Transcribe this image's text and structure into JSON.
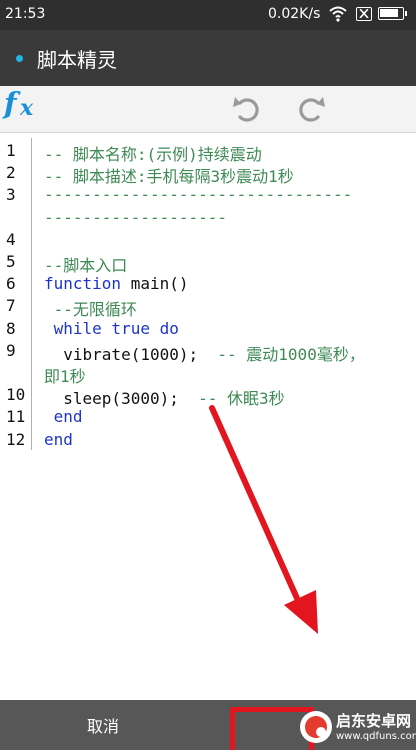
{
  "status_bar": {
    "time": "21:53",
    "net_speed": "0.02K/s",
    "battery_level": 0.9,
    "icons": [
      "wifi-icon",
      "sim-disabled-icon",
      "battery-icon"
    ]
  },
  "app_bar": {
    "title": "脚本精灵",
    "accent_color": "#1fb5e9"
  },
  "toolbar": {
    "undo_icon": "undo-icon",
    "redo_icon": "redo-icon",
    "fx_f": "f",
    "fx_x": "x",
    "fx_color": "#1b8fd8"
  },
  "editor": {
    "line_numbers": [
      "1",
      "2",
      "3",
      "4",
      "5",
      "6",
      "7",
      "8",
      "9",
      "10",
      "11",
      "12"
    ],
    "lines": [
      {
        "no": "1",
        "tokens": [
          {
            "t": "-- 脚本名称:(示例)持续震动",
            "k": "comment"
          }
        ]
      },
      {
        "no": "2",
        "tokens": [
          {
            "t": "-- 脚本描述:手机每隔3秒震动1秒",
            "k": "comment"
          }
        ]
      },
      {
        "no": "3",
        "tokens": [
          {
            "t": "--------------------------------",
            "k": "comment"
          }
        ]
      },
      {
        "no": "3b",
        "tokens": [
          {
            "t": "-------------------",
            "k": "comment"
          }
        ]
      },
      {
        "no": "4",
        "tokens": []
      },
      {
        "no": "5",
        "tokens": [
          {
            "t": "--脚本入口",
            "k": "comment"
          }
        ]
      },
      {
        "no": "6",
        "tokens": [
          {
            "t": "function",
            "k": "keyword"
          },
          {
            "t": " main()",
            "k": "plain"
          }
        ]
      },
      {
        "no": "7",
        "tokens": [
          {
            "t": " --无限循环",
            "k": "comment"
          }
        ]
      },
      {
        "no": "8",
        "tokens": [
          {
            "t": " while true do",
            "k": "keyword"
          }
        ]
      },
      {
        "no": "9",
        "tokens": [
          {
            "t": "  vibrate(1000);  ",
            "k": "plain"
          },
          {
            "t": "-- 震动1000毫秒，",
            "k": "comment"
          }
        ]
      },
      {
        "no": "9b",
        "tokens": [
          {
            "t": "即1秒",
            "k": "comment"
          }
        ]
      },
      {
        "no": "10",
        "tokens": [
          {
            "t": "  sleep(3000);  ",
            "k": "plain"
          },
          {
            "t": "-- 休眠3秒",
            "k": "comment"
          }
        ]
      },
      {
        "no": "11",
        "tokens": [
          {
            "t": " end",
            "k": "keyword"
          }
        ]
      },
      {
        "no": "12",
        "tokens": [
          {
            "t": "end",
            "k": "keyword"
          }
        ]
      }
    ],
    "colors": {
      "comment": "#3e8a55",
      "keyword": "#1d34c9",
      "plain": "#111111"
    }
  },
  "annotation": {
    "arrow_color": "#e3151f",
    "highlight_color": "#e3151f"
  },
  "bottom_bar": {
    "cancel_label": "取消"
  },
  "watermark": {
    "title": "启东安卓网",
    "url": "www.qdfuns.com"
  }
}
